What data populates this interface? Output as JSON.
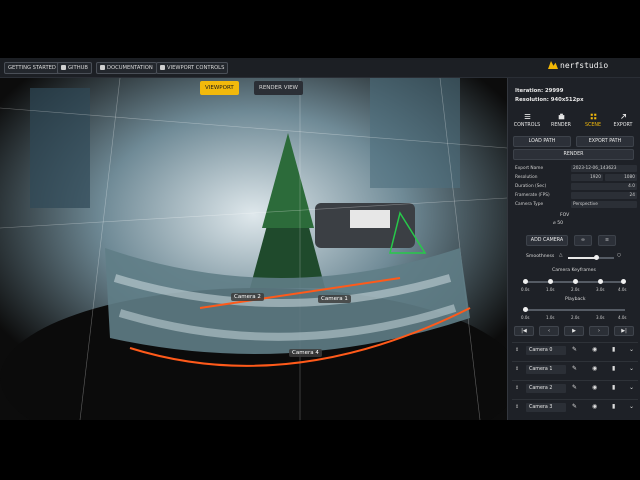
{
  "topbar": {
    "buttons": [
      "GETTING STARTED",
      "GITHUB",
      "DOCUMENTATION",
      "VIEWPORT CONTROLS"
    ],
    "logo_text": "nerfstudio"
  },
  "viewport": {
    "toggle_viewport": "VIEWPORT",
    "toggle_render": "RENDER VIEW",
    "camera_labels": [
      "Camera 2",
      "Camera 1",
      "Camera 4"
    ]
  },
  "panel": {
    "iteration": "Iteration: 29999",
    "resolution": "Resolution: 940x512px",
    "tabs": [
      "CONTROLS",
      "RENDER",
      "SCENE",
      "EXPORT"
    ],
    "load_path": "LOAD PATH",
    "export_path": "EXPORT PATH",
    "render": "RENDER",
    "fields": [
      {
        "label": "Export Name",
        "value": "2023-12-06_143623"
      },
      {
        "label": "Resolution",
        "value_a": "1920",
        "value_b": "1080"
      },
      {
        "label": "Duration (Sec)",
        "value": "4.0"
      },
      {
        "label": "Framerate (FPS)",
        "value": "24"
      },
      {
        "label": "Camera Type",
        "value": "Perspective"
      }
    ],
    "fov_label": "FOV",
    "fov_value": "50",
    "add_camera": "ADD CAMERA",
    "smoothness_label": "Smoothness",
    "keyframes_label": "Camera Keyframes",
    "keyframe_ticks": [
      "0.0s",
      "1.0s",
      "2.0s",
      "3.0s",
      "4.0s"
    ],
    "playback_label": "Playback",
    "playback_ticks": [
      "0.0s",
      "1.0s",
      "2.0s",
      "3.0s",
      "4.0s"
    ],
    "cameras": [
      "Camera 0",
      "Camera 1",
      "Camera 2",
      "Camera 3"
    ]
  }
}
